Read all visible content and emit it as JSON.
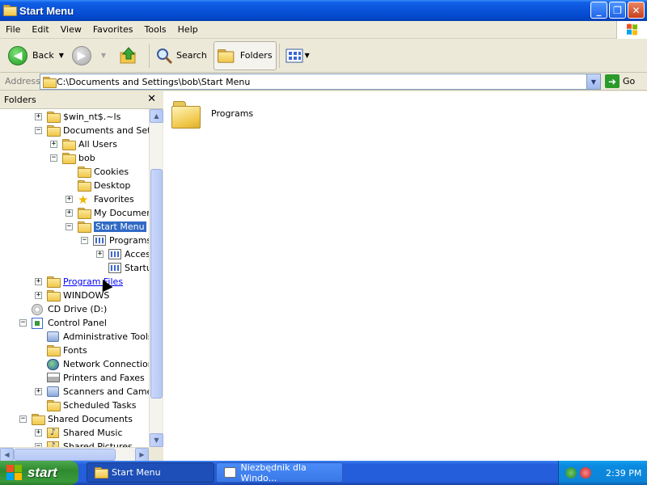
{
  "window": {
    "title": "Start Menu",
    "minimize": "_",
    "maximize": "❐",
    "close": "✕"
  },
  "menubar": [
    "File",
    "Edit",
    "View",
    "Favorites",
    "Tools",
    "Help"
  ],
  "toolbar": {
    "back": "Back",
    "search": "Search",
    "folders": "Folders"
  },
  "address": {
    "label": "Address",
    "value": "C:\\Documents and Settings\\bob\\Start Menu",
    "go": "Go"
  },
  "folders_pane": {
    "title": "Folders",
    "close": "✕",
    "items": [
      {
        "label": "$win_nt$.~ls",
        "exp": "+",
        "icon": "folder"
      },
      {
        "label": "Documents and Settin",
        "exp": "−",
        "icon": "folder"
      },
      {
        "label": "All Users",
        "exp": "+",
        "icon": "folder"
      },
      {
        "label": "bob",
        "exp": "−",
        "icon": "folder"
      },
      {
        "label": "Cookies",
        "exp": "",
        "icon": "folder"
      },
      {
        "label": "Desktop",
        "exp": "",
        "icon": "folder"
      },
      {
        "label": "Favorites",
        "exp": "+",
        "icon": "star"
      },
      {
        "label": "My Documents",
        "exp": "+",
        "icon": "folder"
      },
      {
        "label": "Start Menu",
        "exp": "−",
        "icon": "folder"
      },
      {
        "label": "Programs",
        "exp": "−",
        "icon": "programs"
      },
      {
        "label": "Accessories",
        "exp": "+",
        "icon": "programs"
      },
      {
        "label": "Startup",
        "exp": "",
        "icon": "programs"
      },
      {
        "label": "Program Files",
        "exp": "+",
        "icon": "folder"
      },
      {
        "label": "WINDOWS",
        "exp": "+",
        "icon": "folder"
      },
      {
        "label": "CD Drive (D:)",
        "exp": "",
        "icon": "cd"
      },
      {
        "label": "Control Panel",
        "exp": "−",
        "icon": "controlpanel"
      },
      {
        "label": "Administrative Tools",
        "exp": "",
        "icon": "generic"
      },
      {
        "label": "Fonts",
        "exp": "",
        "icon": "folder"
      },
      {
        "label": "Network Connections",
        "exp": "",
        "icon": "network"
      },
      {
        "label": "Printers and Faxes",
        "exp": "",
        "icon": "printer"
      },
      {
        "label": "Scanners and Cameras",
        "exp": "+",
        "icon": "generic"
      },
      {
        "label": "Scheduled Tasks",
        "exp": "",
        "icon": "folder"
      },
      {
        "label": "Shared Documents",
        "exp": "−",
        "icon": "folder"
      },
      {
        "label": "Shared Music",
        "exp": "+",
        "icon": "music"
      },
      {
        "label": "Shared Pictures",
        "exp": "−",
        "icon": "music"
      }
    ]
  },
  "content": {
    "items": [
      {
        "label": "Programs",
        "icon": "folder-large"
      }
    ]
  },
  "taskbar": {
    "start": "start",
    "tasks": [
      {
        "label": "Start Menu",
        "active": true
      },
      {
        "label": "Niezbędnik dla Windo...",
        "active": false
      }
    ],
    "clock": "2:39 PM"
  }
}
